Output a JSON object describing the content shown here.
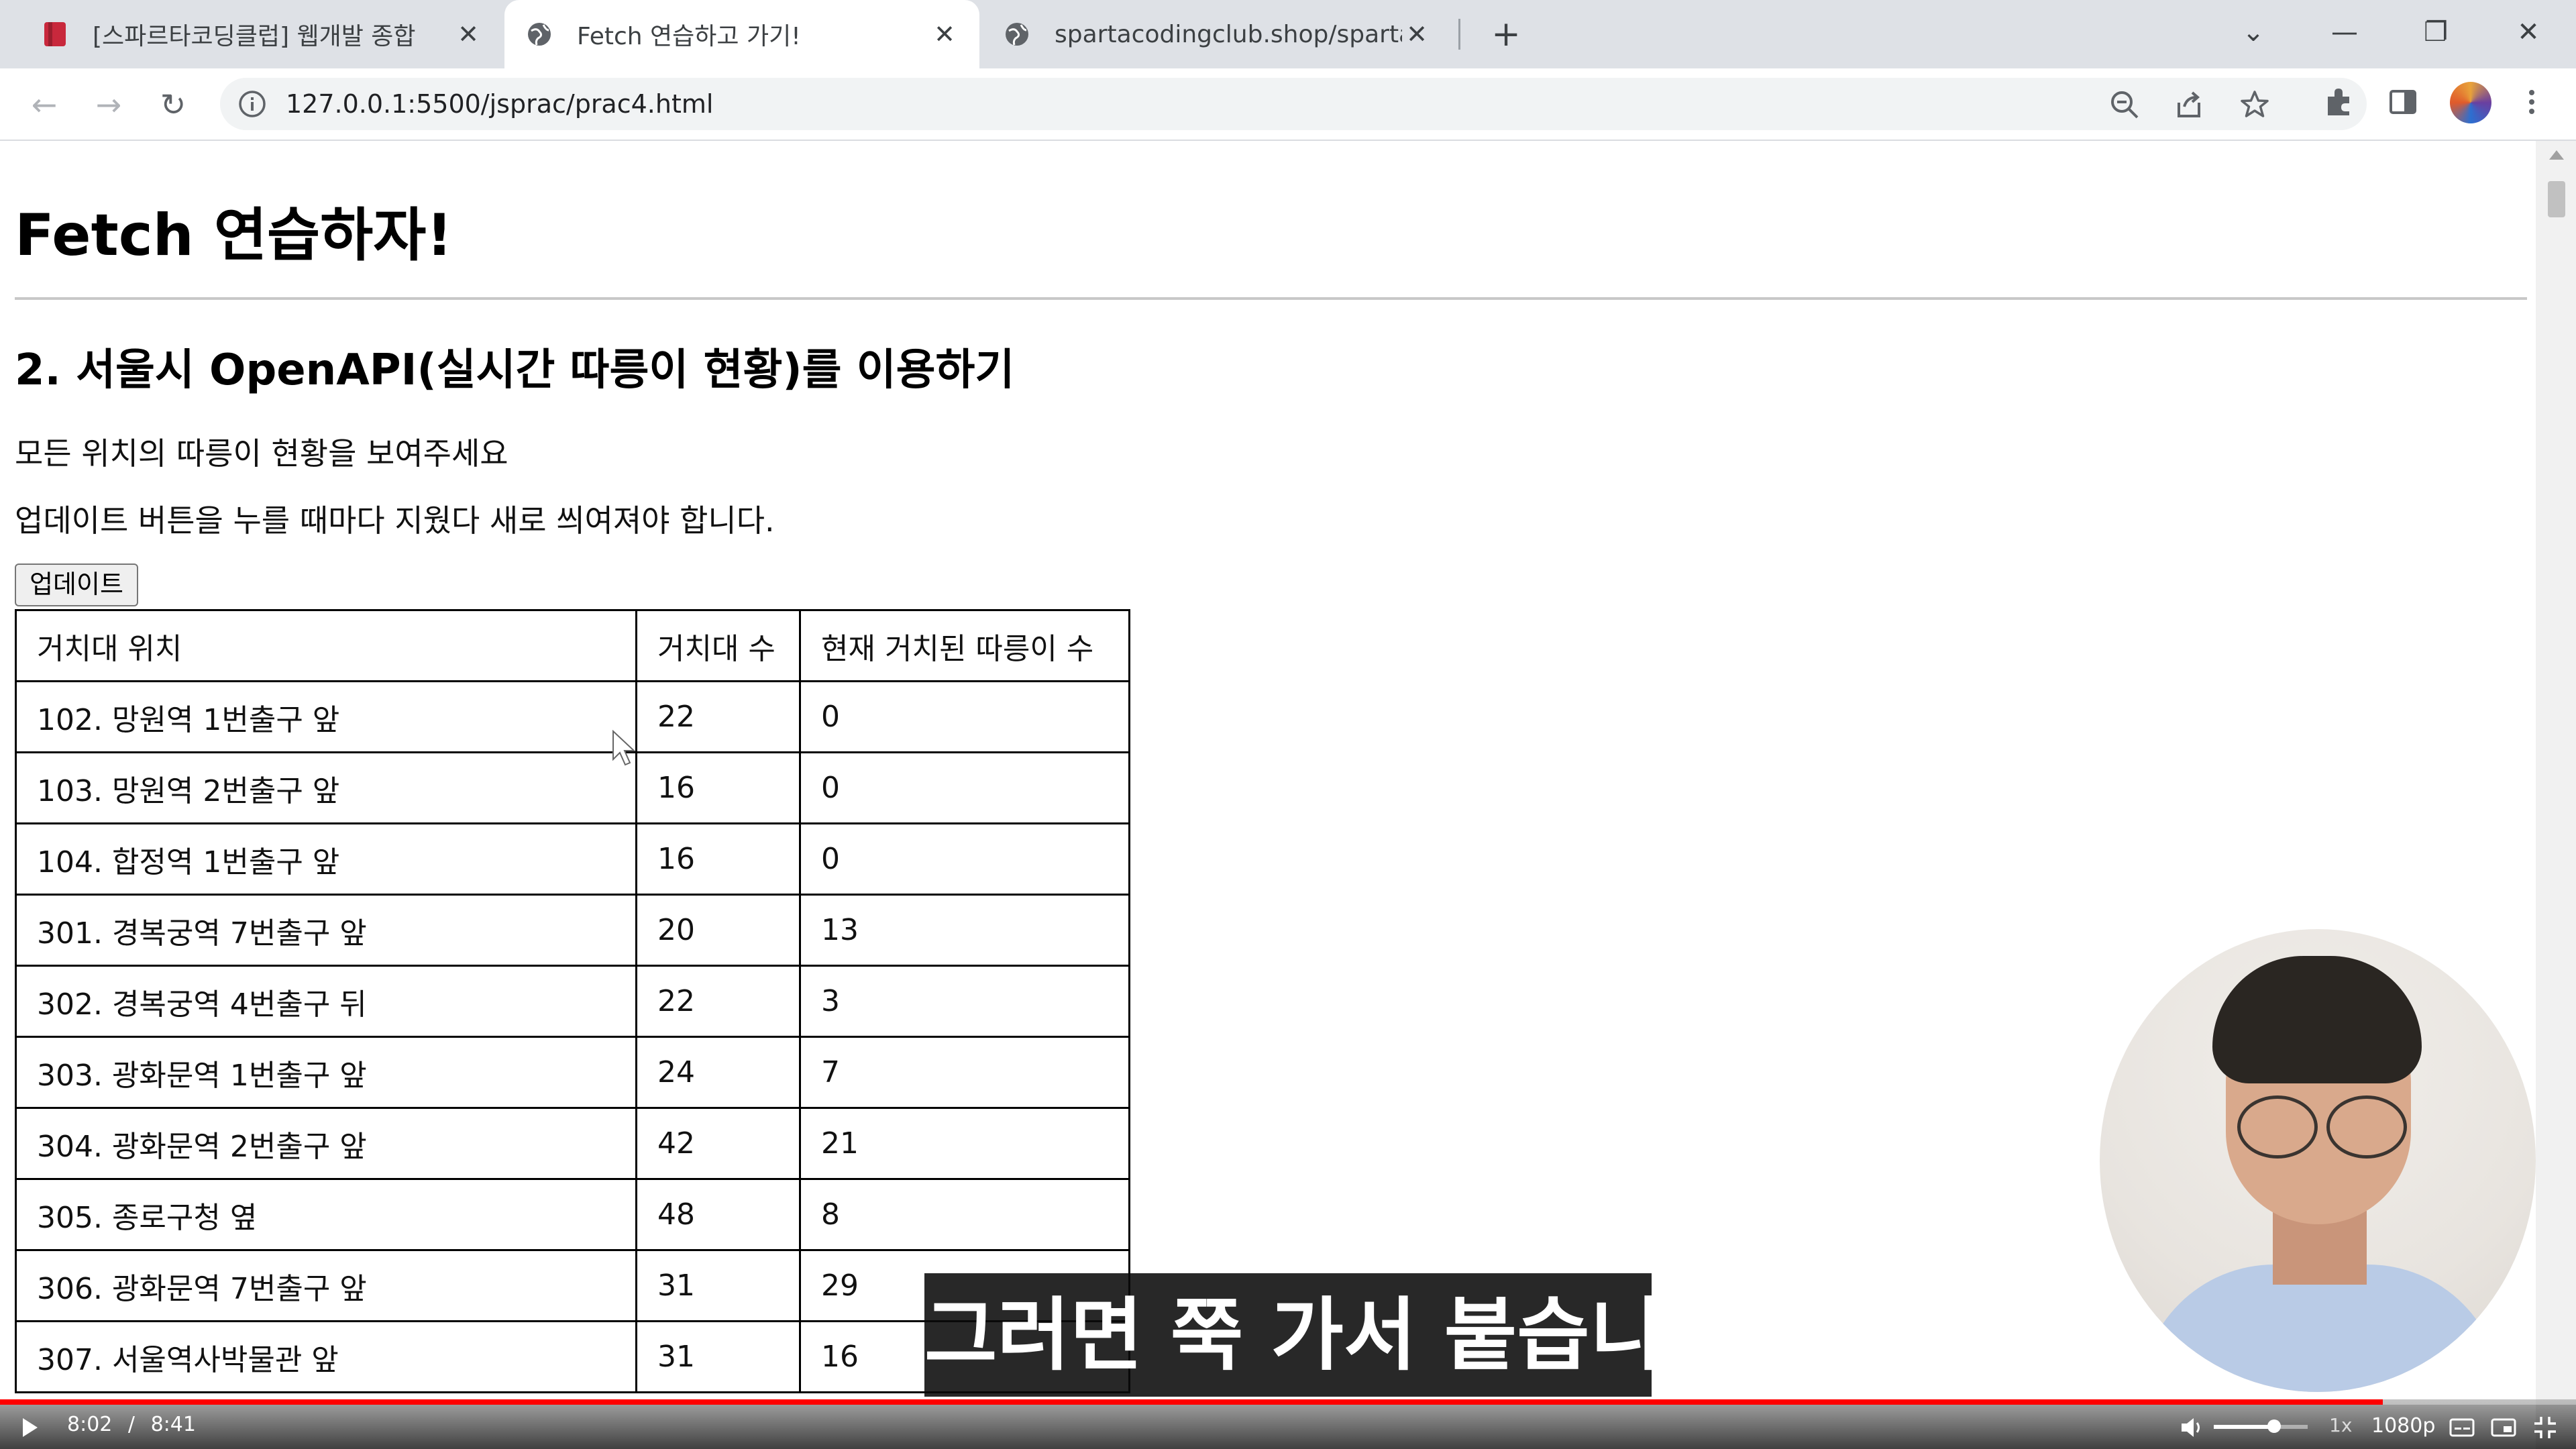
{
  "browser": {
    "tabs": [
      {
        "label": "[스파르타코딩클럽] 웹개발 종합",
        "icon": "bookmark-icon",
        "active": false
      },
      {
        "label": "Fetch 연습하고 가기!",
        "icon": "globe-icon",
        "active": true
      },
      {
        "label": "spartacodingclub.shop/sparta_a",
        "icon": "globe-icon",
        "active": false
      }
    ],
    "new_tab_label": "+",
    "url": "127.0.0.1:5500/jsprac/prac4.html"
  },
  "page": {
    "title": "Fetch 연습하자!",
    "section_title": "2. 서울시 OpenAPI(실시간 따릉이 현황)를 이용하기",
    "description1": "모든 위치의 따릉이 현황을 보여주세요",
    "description2": "업데이트 버튼을 누를 때마다 지웠다 새로 씌여져야 합니다.",
    "update_button": "업데이트",
    "table": {
      "headers": [
        "거치대 위치",
        "거치대 수",
        "현재 거치된 따릉이 수"
      ],
      "rows": [
        [
          "102. 망원역 1번출구 앞",
          "22",
          "0"
        ],
        [
          "103. 망원역 2번출구 앞",
          "16",
          "0"
        ],
        [
          "104. 합정역 1번출구 앞",
          "16",
          "0"
        ],
        [
          "301. 경복궁역 7번출구 앞",
          "20",
          "13"
        ],
        [
          "302. 경복궁역 4번출구 뒤",
          "22",
          "3"
        ],
        [
          "303. 광화문역 1번출구 앞",
          "24",
          "7"
        ],
        [
          "304. 광화문역 2번출구 앞",
          "42",
          "21"
        ],
        [
          "305. 종로구청 옆",
          "48",
          "8"
        ],
        [
          "306. 광화문역 7번출구 앞",
          "31",
          "29"
        ],
        [
          "307. 서울역사박물관 앞",
          "31",
          "16"
        ]
      ]
    }
  },
  "video": {
    "caption": "그러면 쭉 가서 붙습니다",
    "current_time": "8:02",
    "separator": "/",
    "duration": "8:41",
    "progress": 0.925,
    "speed": "1x",
    "quality": "1080p"
  },
  "colors": {
    "progress": "#ff0000",
    "tabstrip": "#dee1e6"
  }
}
